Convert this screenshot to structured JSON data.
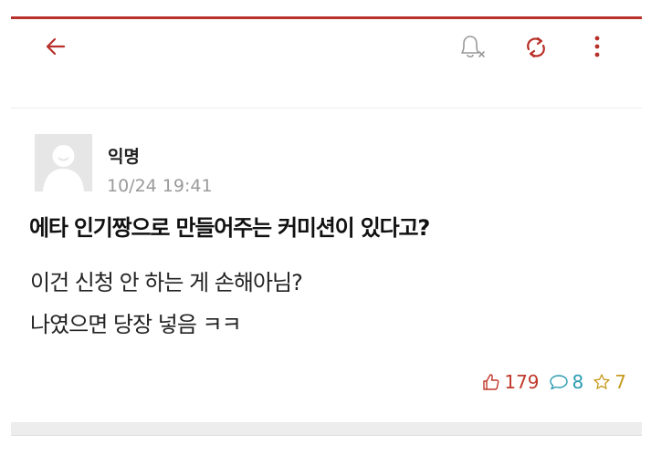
{
  "post": {
    "author": "익명",
    "time": "10/24 19:41",
    "title": "에타 인기짱으로 만들어주는 커미션이 있다고?",
    "body_lines": [
      "이건 신청 안 하는 게 손해아님?",
      "나였으면 당장 넣음 ㅋㅋ"
    ],
    "stats": {
      "likes": "179",
      "comments": "8",
      "scraps": "7"
    }
  },
  "icons": {
    "back": "back-arrow-icon",
    "notification": "bell-off-icon",
    "refresh": "refresh-icon",
    "more": "more-vertical-icon",
    "like": "thumbs-up-icon",
    "comment": "comment-icon",
    "scrap": "star-icon"
  },
  "colors": {
    "accent": "#b8302a",
    "like": "#c0392b",
    "comment": "#2a9bb0",
    "scrap": "#c79a1e"
  }
}
